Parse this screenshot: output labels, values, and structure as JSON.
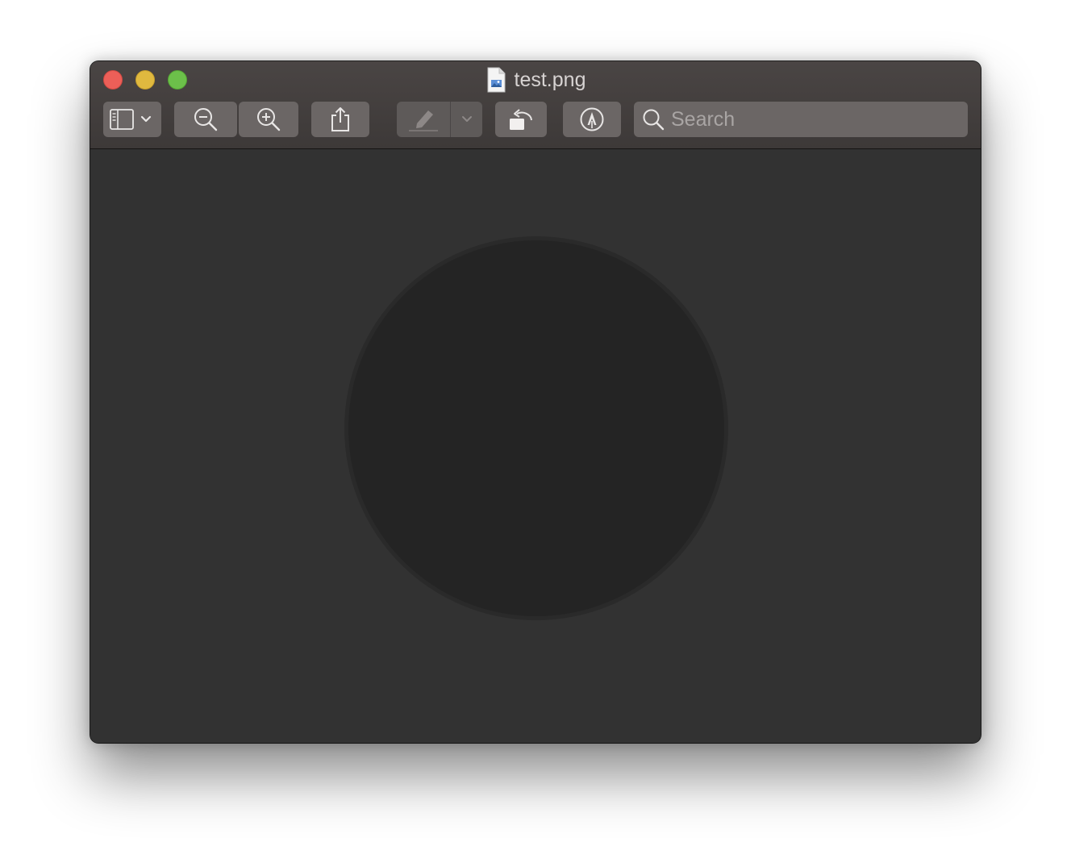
{
  "window": {
    "title": "test.png"
  },
  "titlebar_icons": {
    "document": "png-document-icon"
  },
  "toolbar": {
    "sidebar_button": "sidebar-view-icon",
    "zoom_out": "zoom-out-icon",
    "zoom_in": "zoom-in-icon",
    "share": "share-icon",
    "highlight": "highlighter-icon",
    "rotate": "rotate-left-icon",
    "markup": "markup-pen-icon"
  },
  "search": {
    "placeholder": "Search",
    "value": ""
  },
  "colors": {
    "close": "#ec5f58",
    "minimize": "#e0b93f",
    "maximize": "#6cc04a",
    "canvas": "#323232",
    "circle": "#242424"
  }
}
